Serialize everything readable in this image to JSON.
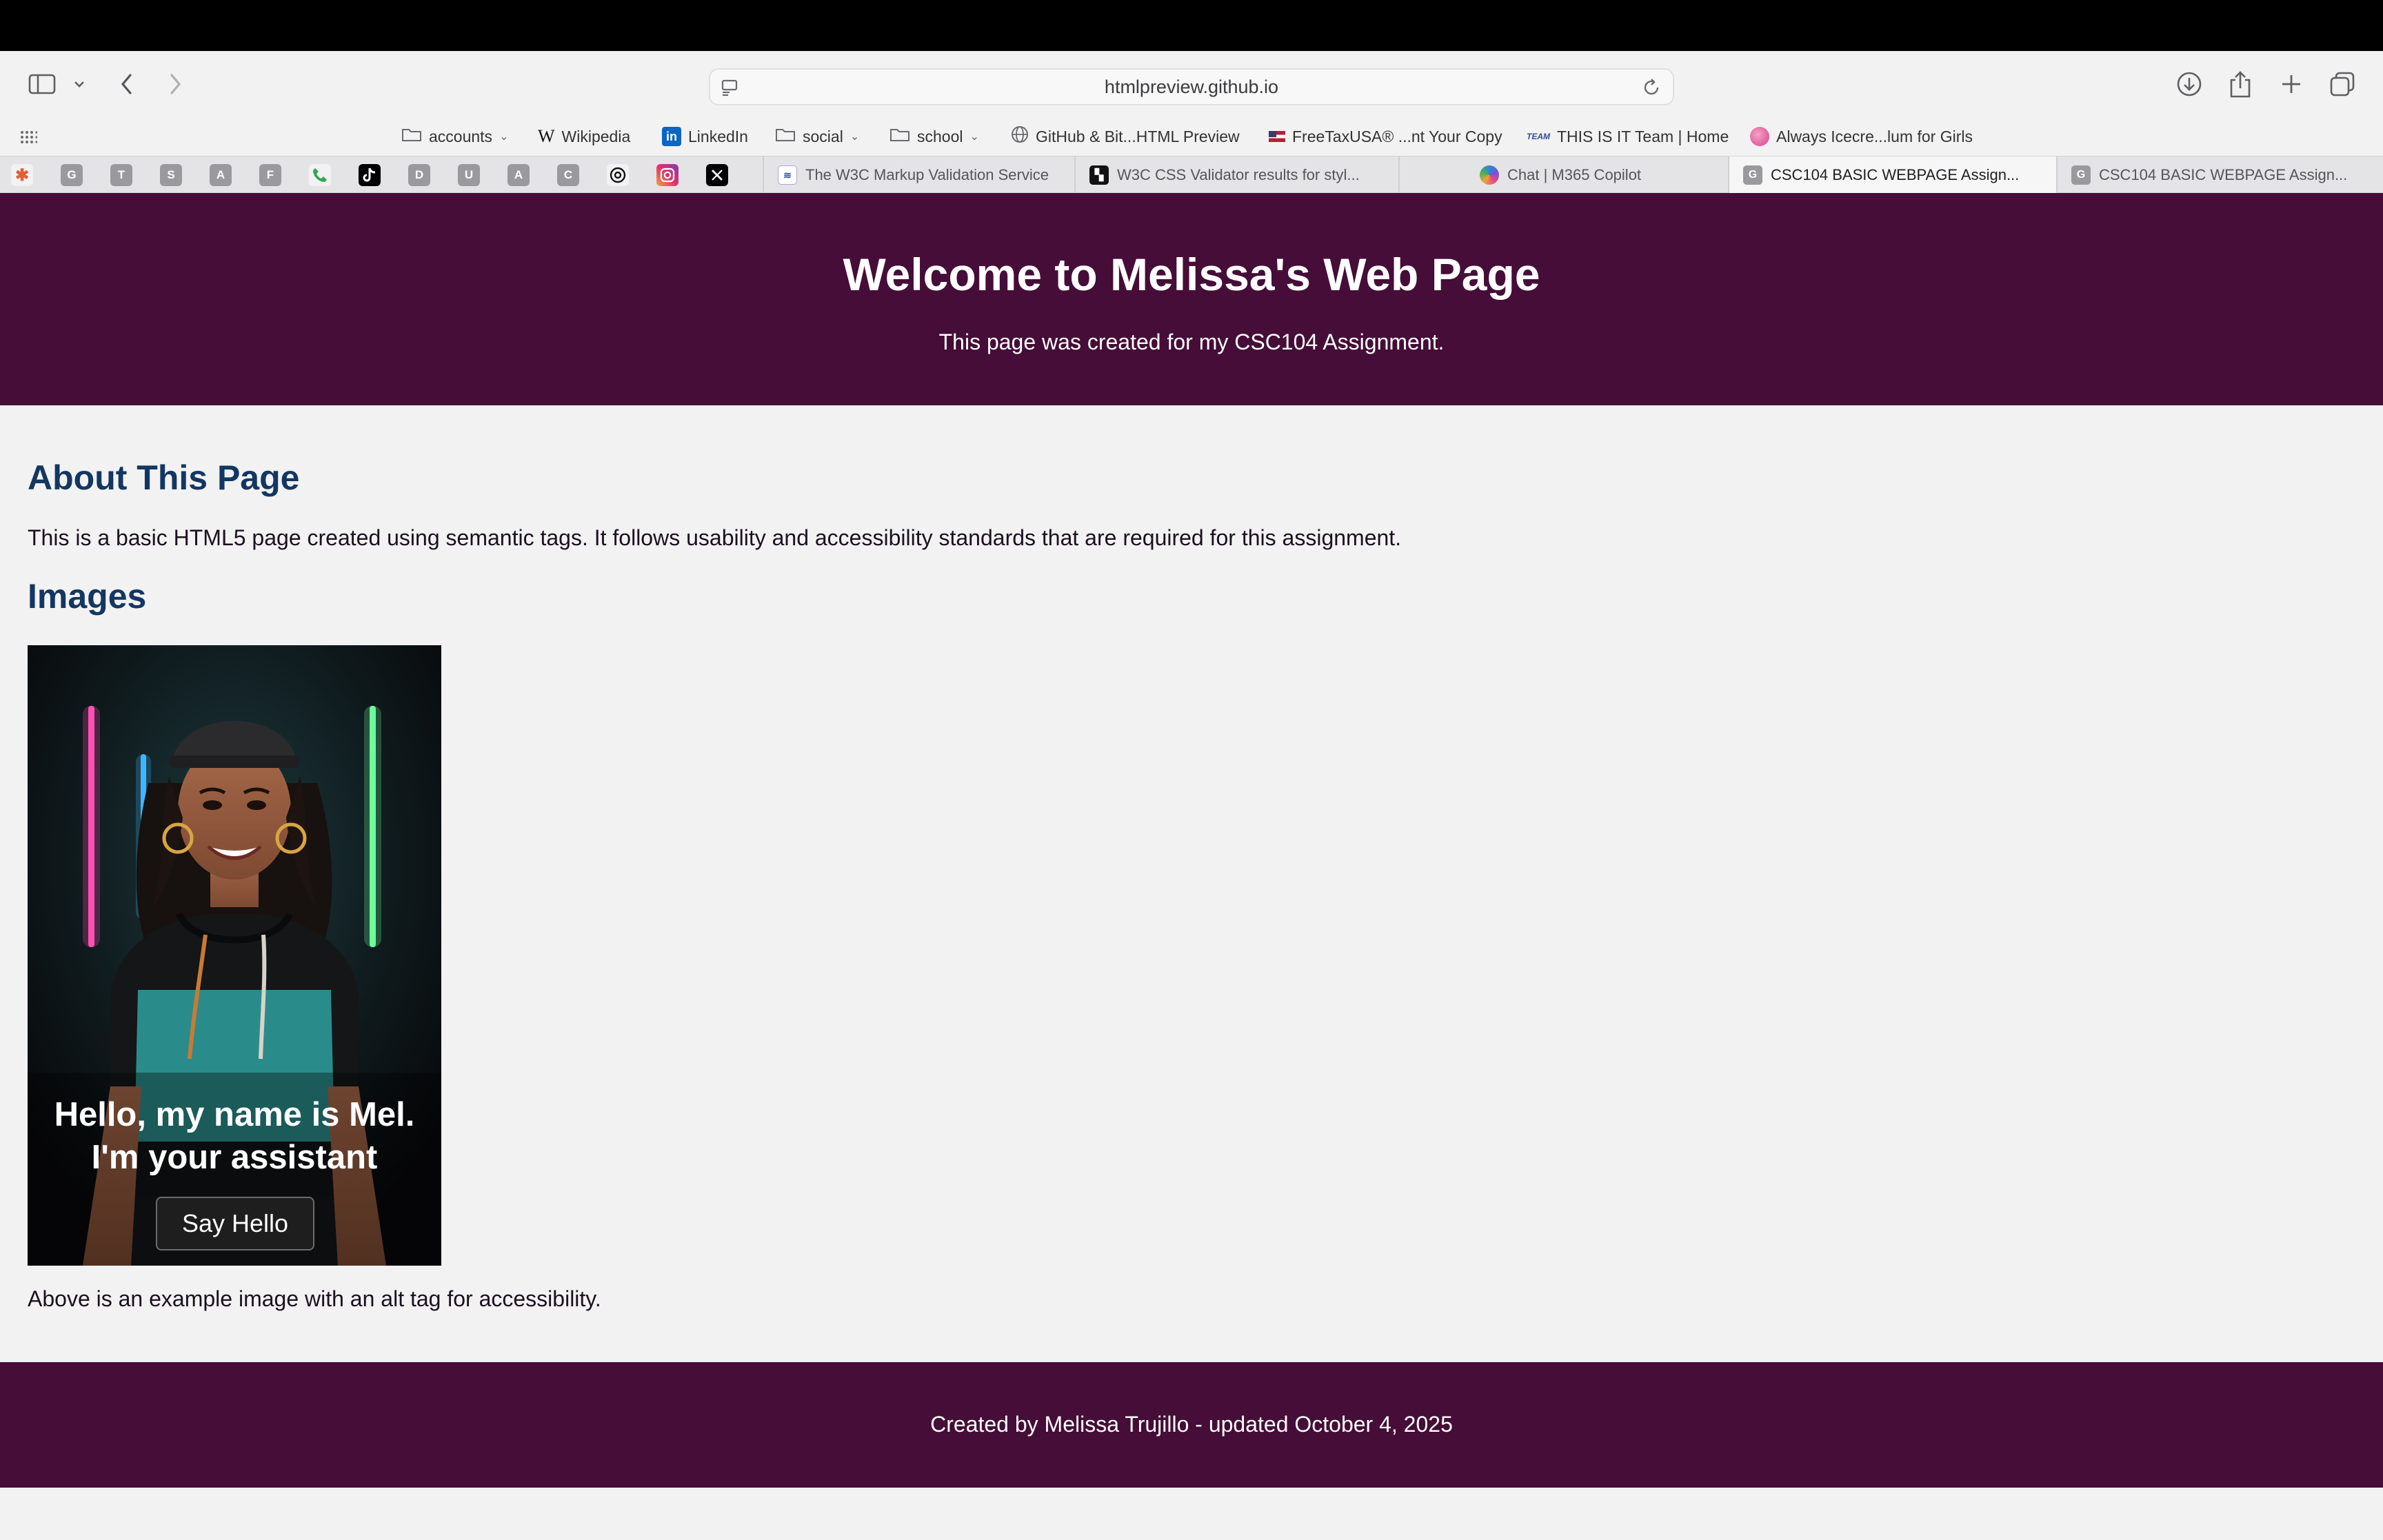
{
  "browser": {
    "address": "htmlpreview.github.io",
    "bookmarks": [
      {
        "label": "accounts",
        "icon": "folder-icon",
        "has_menu": true
      },
      {
        "label": "Wikipedia",
        "icon": "wikipedia-icon",
        "has_menu": false
      },
      {
        "label": "LinkedIn",
        "icon": "linkedin-icon",
        "has_menu": false
      },
      {
        "label": "social",
        "icon": "folder-icon",
        "has_menu": true
      },
      {
        "label": "school",
        "icon": "folder-icon",
        "has_menu": true
      },
      {
        "label": "GitHub & Bit...HTML Preview",
        "icon": "globe-icon",
        "has_menu": false
      },
      {
        "label": "FreeTaxUSA® ...nt Your Copy",
        "icon": "flag-icon",
        "has_menu": false
      },
      {
        "label": "THIS IS IT Team | Home",
        "icon": "team-icon",
        "has_menu": false
      },
      {
        "label": "Always Icecre...lum for Girls",
        "icon": "circle-icon",
        "has_menu": false
      }
    ],
    "pinned_tabs": [
      "G",
      "T",
      "S",
      "A",
      "F",
      "",
      "",
      "D",
      "U",
      "A",
      "C",
      "",
      "",
      ""
    ],
    "tabs": [
      {
        "label": "The W3C Markup Validation Service",
        "active": false
      },
      {
        "label": "W3C CSS Validator results for styl...",
        "active": false
      },
      {
        "label": "Chat | M365 Copilot",
        "active": false
      },
      {
        "label": "CSC104 BASIC WEBPAGE Assign...",
        "fav": "G",
        "active": true
      },
      {
        "label": "CSC104 BASIC WEBPAGE Assign...",
        "fav": "G",
        "active": false
      }
    ]
  },
  "page": {
    "header": {
      "title": "Welcome to Melissa's Web Page",
      "subtitle": "This page was created for my CSC104 Assignment."
    },
    "about": {
      "heading": "About This Page",
      "text": "This is a basic HTML5 page created using semantic tags. It follows usability and accessibility standards that are required for this assignment."
    },
    "images": {
      "heading": "Images",
      "image_text_line1": "Hello, my name is Mel.",
      "image_text_line2": "I'm your assistant",
      "button_label": "Say Hello",
      "caption": "Above is an example image with an alt tag for accessibility."
    },
    "footer": {
      "text": "Created by Melissa Trujillo - updated October 4, 2025"
    }
  },
  "colors": {
    "brand_purple": "#450d37",
    "heading_blue": "#133761",
    "page_background": "#f2f2f2"
  }
}
